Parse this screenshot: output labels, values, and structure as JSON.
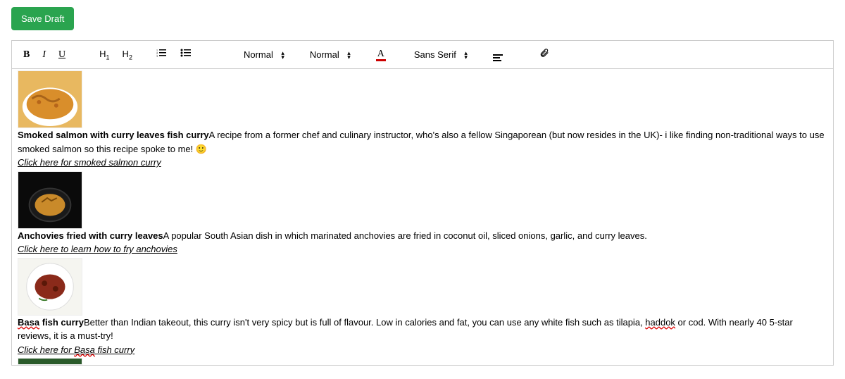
{
  "actions": {
    "save_draft": "Save Draft"
  },
  "toolbar": {
    "heading1": "H1",
    "heading2": "H2",
    "select_normal_1": "Normal",
    "select_normal_2": "Normal",
    "font_family": "Sans Serif"
  },
  "content": {
    "entries": [
      {
        "title": "Smoked salmon with curry leaves fish curry",
        "body": "A recipe from a former chef and culinary instructor, who's also a fellow Singaporean (but now resides in the UK)- i like finding non-traditional ways to use smoked salmon so this recipe spoke to me! 🙂",
        "link": "Click here for smoked salmon curry"
      },
      {
        "title": "Anchovies fried with curry leaves",
        "body": "A popular South Asian dish in which marinated anchovies are fried in coconut oil, sliced onions, garlic, and curry leaves.",
        "link": "Click here to learn how to fry anchovies"
      },
      {
        "title_pre": "Basa",
        "title_post": " fish curry",
        "body_pre": "Better than Indian takeout, this curry isn't very spicy but is full of flavour. Low in calories and fat, you can use any white fish such as tilapia, ",
        "body_mid": "haddok",
        "body_post": " or cod. With nearly 40 5-star reviews, it is a must-try!",
        "link_pre": "Click here for ",
        "link_mid": "Basa",
        "link_post": " fish curry"
      }
    ]
  }
}
